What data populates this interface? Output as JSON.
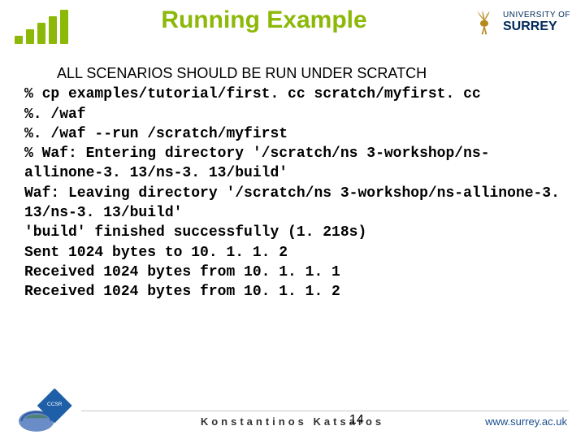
{
  "header": {
    "title": "Running Example",
    "logo_top": "UNIVERSITY OF",
    "logo_bottom": "SURREY"
  },
  "body": {
    "caption": "ALL SCENARIOS SHOULD BE RUN UNDER SCRATCH",
    "lines": [
      "% cp examples/tutorial/first. cc scratch/myfirst. cc",
      "%. /waf",
      "%. /waf --run /scratch/myfirst",
      "% Waf: Entering directory '/scratch/ns 3-workshop/ns-allinone-3. 13/ns-3. 13/build'",
      "Waf: Leaving directory '/scratch/ns 3-workshop/ns-allinone-3. 13/ns-3. 13/build'",
      "'build' finished successfully (1. 218s)",
      "Sent 1024 bytes to 10. 1. 1. 2",
      "Received 1024 bytes from 10. 1. 1. 1",
      "Received 1024 bytes from 10. 1. 1. 2"
    ]
  },
  "footer": {
    "author": "Konstantinos Katsaros",
    "page": "14",
    "url": "www.surrey.ac.uk"
  }
}
